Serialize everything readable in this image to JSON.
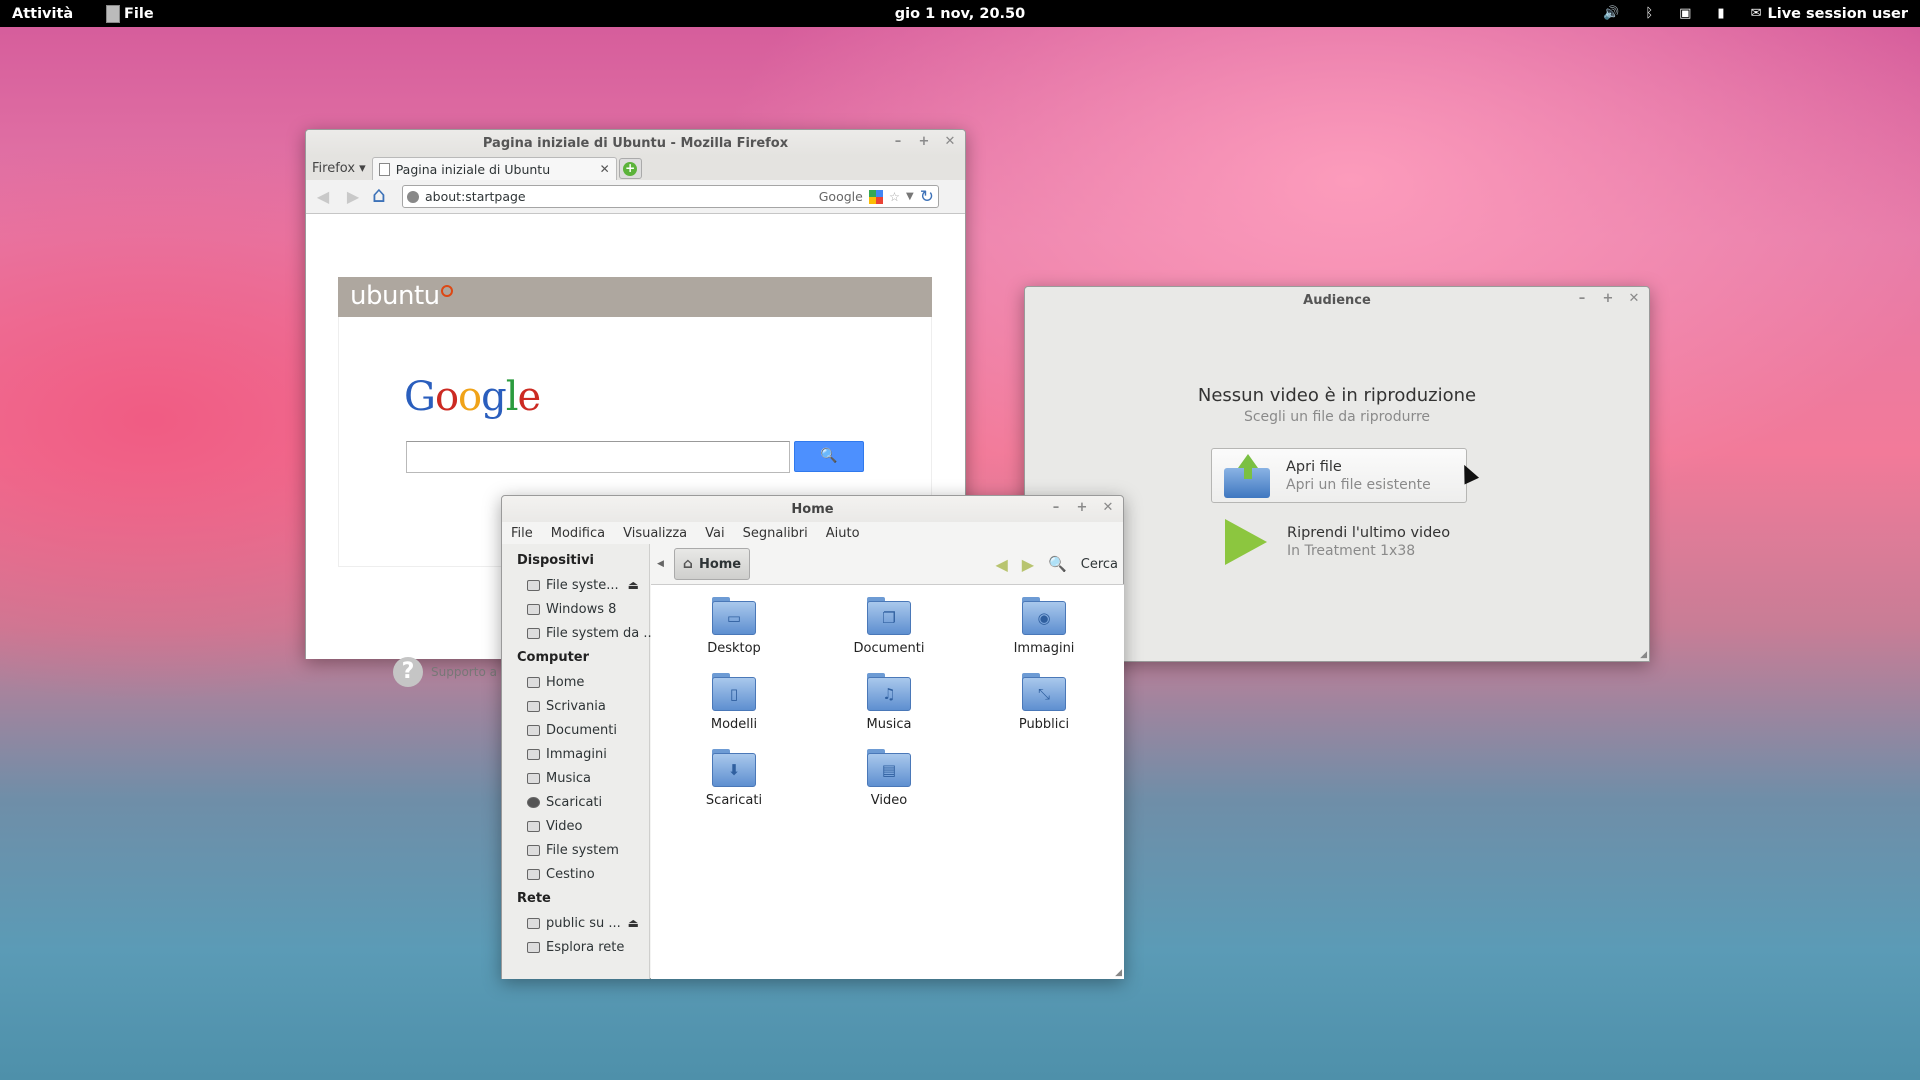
{
  "topbar": {
    "activities": "Attività",
    "app_menu": "File",
    "clock": "gio  1 nov, 20.50",
    "user": "Live session user",
    "status_icons": [
      "volume-icon",
      "bluetooth-icon",
      "network-icon",
      "battery-icon",
      "chat-icon"
    ]
  },
  "firefox": {
    "title": "Pagina iniziale di Ubuntu - Mozilla Firefox",
    "menu_button": "Firefox ▾",
    "tab_label": "Pagina iniziale di Ubuntu",
    "url": "about:startpage",
    "search_engine": "Google",
    "banner": "ubuntu",
    "support_text": "Supporto a U"
  },
  "audience": {
    "title": "Audience",
    "heading": "Nessun video è in riproduzione",
    "subheading": "Scegli un file da riprodurre",
    "open_title": "Apri file",
    "open_sub": "Apri un file esistente",
    "resume_title": "Riprendi l'ultimo video",
    "resume_sub": "In Treatment 1x38"
  },
  "nautilus": {
    "title": "Home",
    "menu": [
      "File",
      "Modifica",
      "Visualizza",
      "Vai",
      "Segnalibri",
      "Aiuto"
    ],
    "sections": {
      "devices": "Dispositivi",
      "computer": "Computer",
      "network": "Rete"
    },
    "devices": [
      "File syste...",
      "Windows 8",
      "File system da ..."
    ],
    "computer": [
      "Home",
      "Scrivania",
      "Documenti",
      "Immagini",
      "Musica",
      "Scaricati",
      "Video",
      "File system",
      "Cestino"
    ],
    "network": [
      "public su ...",
      "Esplora rete"
    ],
    "crumb": "Home",
    "search_label": "Cerca",
    "files": [
      "Desktop",
      "Documenti",
      "Immagini",
      "Modelli",
      "Musica",
      "Pubblici",
      "Scaricati",
      "Video"
    ]
  }
}
